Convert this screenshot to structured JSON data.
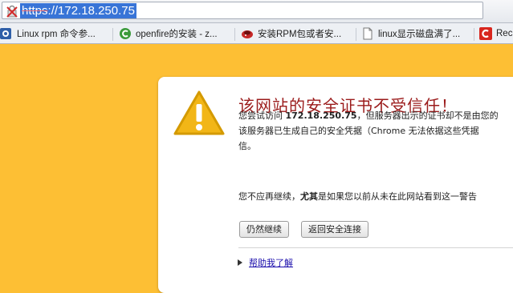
{
  "address_bar": {
    "url_scheme": "https",
    "url_rest": "://172.18.250.75",
    "selection_color": "#3874d7"
  },
  "bookmarks": [
    {
      "label": "Linux rpm 命令参...",
      "icon": "linux-favicon"
    },
    {
      "label": "openfire的安装 - z...",
      "icon": "c-favicon"
    },
    {
      "label": "安装RPM包或者安...",
      "icon": "rpm-favicon"
    },
    {
      "label": "linux显示磁盘满了...",
      "icon": "page-icon"
    },
    {
      "label": "Rec",
      "icon": "red-c-favicon"
    }
  ],
  "warning": {
    "title": "该网站的安全证书不受信任！",
    "p1_before": "您尝试访问 ",
    "p1_host": "172.18.250.75",
    "p1_after": "，但服务器出示的证书却不是由您的",
    "p1_line2": "该服务器已生成自己的安全凭据（Chrome 无法依据这些凭据",
    "p1_line3": "信。",
    "p2_before": "您不应再继续，",
    "p2_bold": "尤其",
    "p2_after": "是如果您以前从未在此网站看到这一警告",
    "continue_button": "仍然继续",
    "back_button": "返回安全连接",
    "help_link": "帮助我了解"
  },
  "colors": {
    "page_background": "#fdbf34",
    "title": "#9b1b1b",
    "link": "#1a0dab"
  }
}
